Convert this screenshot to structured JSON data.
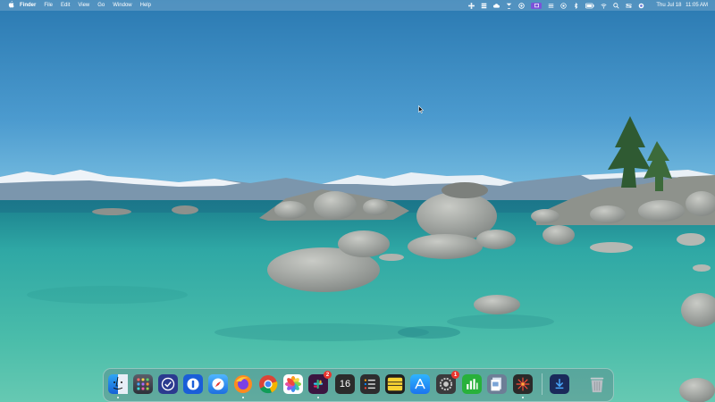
{
  "menubar": {
    "apple_icon": "apple-logo",
    "items": [
      "Finder",
      "File",
      "Edit",
      "View",
      "Go",
      "Window",
      "Help"
    ],
    "clock": {
      "day": "Thu Jul 18",
      "time": "11:05 AM"
    }
  },
  "dock": {
    "apps": [
      {
        "name": "finder",
        "icon": "finder-icon"
      },
      {
        "name": "launchpad",
        "icon": "launchpad-icon"
      },
      {
        "name": "omnifocus",
        "icon": "check-icon"
      },
      {
        "name": "1password",
        "icon": "1password-icon"
      },
      {
        "name": "safari",
        "icon": "compass-icon"
      },
      {
        "name": "firefox",
        "icon": "firefox-icon"
      },
      {
        "name": "chrome",
        "icon": "chrome-icon"
      },
      {
        "name": "photos",
        "icon": "photos-icon"
      },
      {
        "name": "slack",
        "icon": "slack-icon",
        "badge": "2"
      },
      {
        "name": "calendar",
        "icon": "calendar-icon",
        "label": "16"
      },
      {
        "name": "reminders",
        "icon": "list-icon"
      },
      {
        "name": "notes",
        "icon": "notes-icon"
      },
      {
        "name": "app-store",
        "icon": "app-store-icon"
      },
      {
        "name": "system-settings",
        "icon": "gear-icon",
        "badge": "1"
      },
      {
        "name": "numbers",
        "icon": "chart-icon"
      },
      {
        "name": "preview",
        "icon": "preview-icon"
      },
      {
        "name": "burst",
        "icon": "burst-icon"
      },
      {
        "name": "downloads",
        "icon": "downloads-icon"
      },
      {
        "name": "trash",
        "icon": "trash-icon"
      }
    ]
  },
  "colors": {
    "sky_top": "#2d7fb6",
    "sky_bottom": "#6bb6de",
    "water_deep": "#1a8f8a",
    "water_shallow": "#5fc9b7",
    "mountain": "#7f9bb3",
    "snow": "#f1f6fa",
    "rock": "#a8aaa5",
    "badge_red": "#e8352e"
  }
}
